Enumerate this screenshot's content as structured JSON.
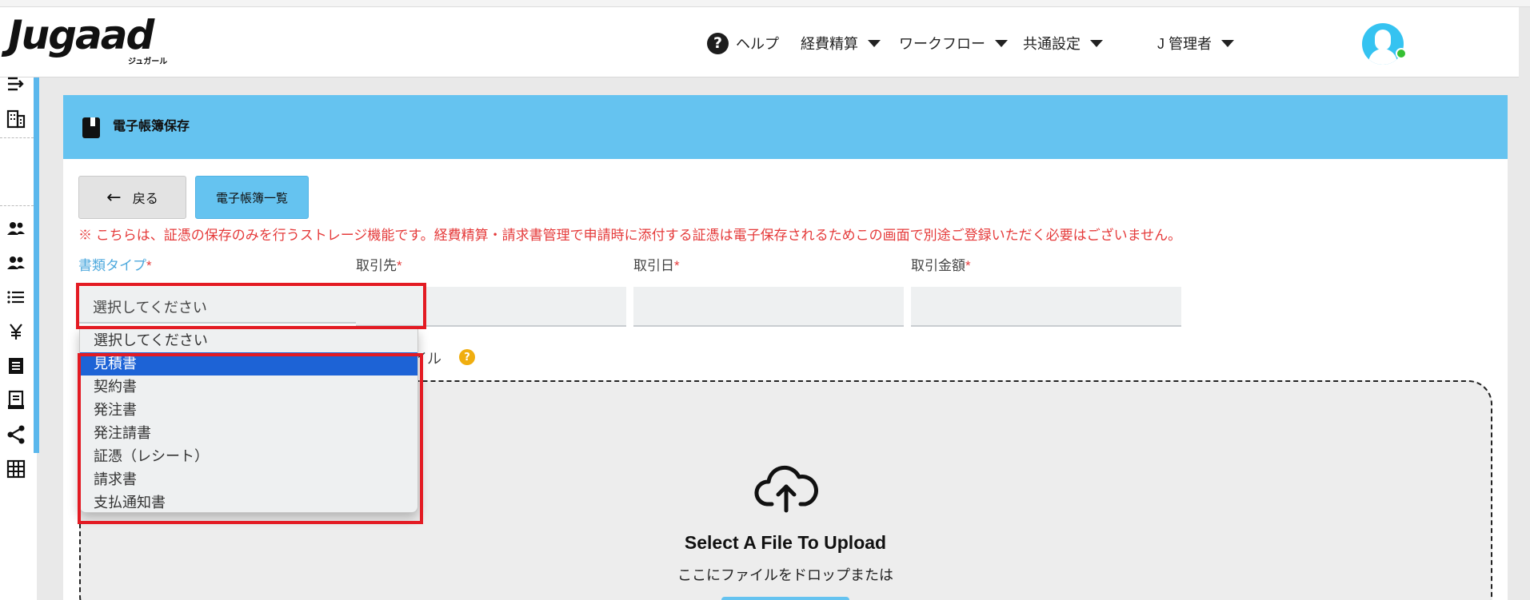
{
  "brand": {
    "logo": "Jugaad",
    "logo_kana": "ジュガール"
  },
  "header": {
    "help": "ヘルプ",
    "menu_expense": "経費精算",
    "menu_workflow": "ワークフロー",
    "menu_common": "共通設定",
    "user": "J 管理者"
  },
  "page": {
    "title": "電子帳簿保存",
    "back_label": "戻る",
    "list_label": "電子帳簿一覧",
    "notice": "※ こちらは、証憑の保存のみを行うストレージ機能です。経費精算・請求書管理で申請時に添付する証憑は電子保存されるためこの画面で別途ご登録いただく必要はございません。"
  },
  "form": {
    "doc_type_label": "書類タイプ",
    "partner_label": "取引先",
    "date_label": "取引日",
    "amount_label": "取引金額",
    "required_mark": "*",
    "select_placeholder": "選択してください",
    "options": [
      "選択してください",
      "見積書",
      "契約書",
      "発注書",
      "発注請書",
      "証憑（レシート）",
      "請求書",
      "支払通知書"
    ],
    "selected_option": "見積書",
    "upload_label_partial": "イル"
  },
  "dropzone": {
    "title": "Select A File To Upload",
    "subtitle": "ここにファイルをドロップまたは"
  },
  "colors": {
    "accent": "#65c3f0",
    "error": "#e53b3b",
    "highlight": "#e31b23",
    "selected": "#1d63d6"
  }
}
